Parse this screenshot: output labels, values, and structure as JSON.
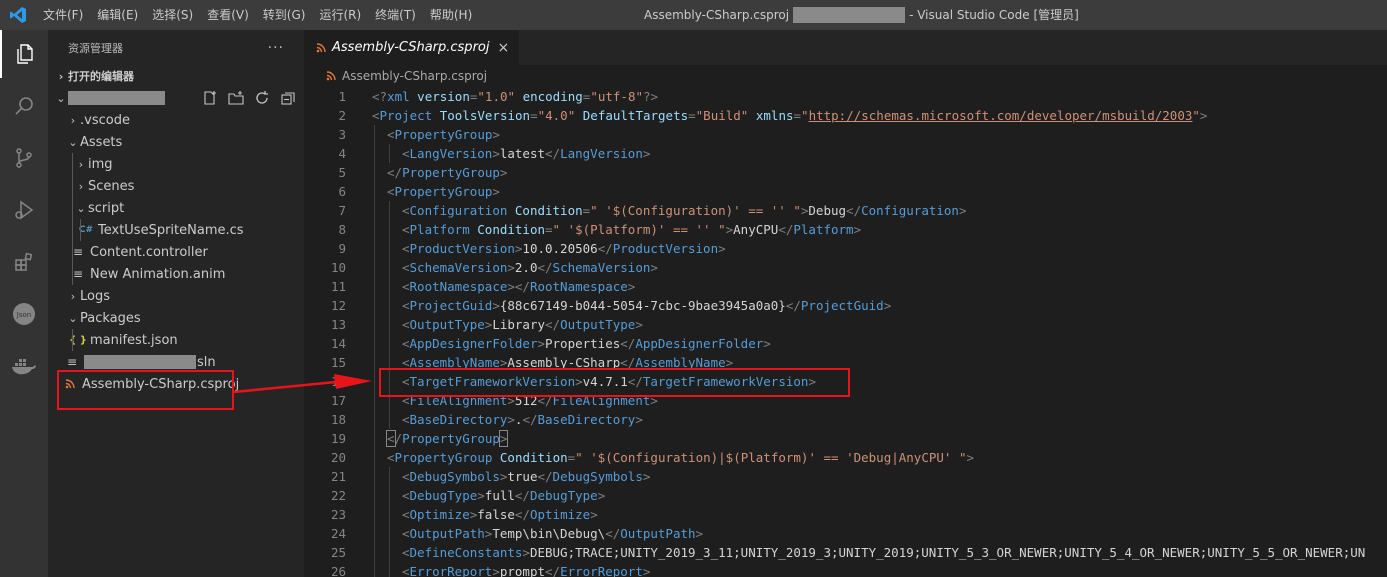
{
  "titlebar": {
    "menus": [
      "文件(F)",
      "编辑(E)",
      "选择(S)",
      "查看(V)",
      "转到(G)",
      "运行(R)",
      "终端(T)",
      "帮助(H)"
    ],
    "title_left": "Assembly-CSharp.csproj",
    "title_right": "- Visual Studio Code [管理员]"
  },
  "activitybar": {
    "icons": [
      "explorer-icon",
      "search-icon",
      "source-control-icon",
      "run-debug-icon",
      "extensions-icon",
      "json-icon",
      "docker-icon"
    ]
  },
  "sidebar": {
    "title": "资源管理器",
    "more": "···",
    "open_editors": "打开的编辑器",
    "tree": [
      {
        "label": ".vscode",
        "twisty": "›"
      },
      {
        "label": "Assets",
        "twisty": "⌄"
      },
      {
        "label": "img",
        "twisty": "›"
      },
      {
        "label": "Scenes",
        "twisty": "›"
      },
      {
        "label": "script",
        "twisty": "⌄"
      },
      {
        "label": "TextUseSpriteName.cs",
        "icon": "C#"
      },
      {
        "label": "Content.controller",
        "icon": "≡"
      },
      {
        "label": "New Animation.anim",
        "icon": "≡"
      },
      {
        "label": "Logs",
        "twisty": "›"
      },
      {
        "label": "Packages",
        "twisty": "⌄"
      },
      {
        "label": "manifest.json",
        "icon": "{ }"
      },
      {
        "label": "sln",
        "icon": "≡"
      },
      {
        "label": "Assembly-CSharp.csproj",
        "icon": "rss"
      }
    ]
  },
  "editor": {
    "tab_label": "Assembly-CSharp.csproj",
    "tab_close": "×",
    "breadcrumb": "Assembly-CSharp.csproj",
    "lines": [
      {
        "n": "1",
        "indent": 0,
        "tokens": [
          [
            "p",
            "<?"
          ],
          [
            "t",
            "xml "
          ],
          [
            "a",
            "version"
          ],
          [
            "p",
            "="
          ],
          [
            "s",
            "\"1.0\""
          ],
          [
            "x",
            " "
          ],
          [
            "a",
            "encoding"
          ],
          [
            "p",
            "="
          ],
          [
            "s",
            "\"utf-8\""
          ],
          [
            "p",
            "?>"
          ]
        ]
      },
      {
        "n": "2",
        "indent": 0,
        "tokens": [
          [
            "p",
            "<"
          ],
          [
            "t",
            "Project "
          ],
          [
            "a",
            "ToolsVersion"
          ],
          [
            "p",
            "="
          ],
          [
            "s",
            "\"4.0\""
          ],
          [
            "x",
            " "
          ],
          [
            "a",
            "DefaultTargets"
          ],
          [
            "p",
            "="
          ],
          [
            "s",
            "\"Build\""
          ],
          [
            "x",
            " "
          ],
          [
            "a",
            "xmlns"
          ],
          [
            "p",
            "="
          ],
          [
            "s",
            "\""
          ],
          [
            "u",
            "http://schemas.microsoft.com/developer/msbuild/2003"
          ],
          [
            "s",
            "\""
          ],
          [
            "p",
            ">"
          ]
        ]
      },
      {
        "n": "3",
        "indent": 1,
        "tokens": [
          [
            "p",
            "<"
          ],
          [
            "t",
            "PropertyGroup"
          ],
          [
            "p",
            ">"
          ]
        ]
      },
      {
        "n": "4",
        "indent": 2,
        "tokens": [
          [
            "p",
            "<"
          ],
          [
            "t",
            "LangVersion"
          ],
          [
            "p",
            ">"
          ],
          [
            "x",
            "latest"
          ],
          [
            "p",
            "</"
          ],
          [
            "t",
            "LangVersion"
          ],
          [
            "p",
            ">"
          ]
        ]
      },
      {
        "n": "5",
        "indent": 1,
        "tokens": [
          [
            "p",
            "</"
          ],
          [
            "t",
            "PropertyGroup"
          ],
          [
            "p",
            ">"
          ]
        ]
      },
      {
        "n": "6",
        "indent": 1,
        "tokens": [
          [
            "p",
            "<"
          ],
          [
            "t",
            "PropertyGroup"
          ],
          [
            "p",
            ">"
          ]
        ]
      },
      {
        "n": "7",
        "indent": 2,
        "tokens": [
          [
            "p",
            "<"
          ],
          [
            "t",
            "Configuration "
          ],
          [
            "a",
            "Condition"
          ],
          [
            "p",
            "="
          ],
          [
            "s",
            "\" '$(Configuration)' == '' \""
          ],
          [
            "p",
            ">"
          ],
          [
            "x",
            "Debug"
          ],
          [
            "p",
            "</"
          ],
          [
            "t",
            "Configuration"
          ],
          [
            "p",
            ">"
          ]
        ]
      },
      {
        "n": "8",
        "indent": 2,
        "tokens": [
          [
            "p",
            "<"
          ],
          [
            "t",
            "Platform "
          ],
          [
            "a",
            "Condition"
          ],
          [
            "p",
            "="
          ],
          [
            "s",
            "\" '$(Platform)' == '' \""
          ],
          [
            "p",
            ">"
          ],
          [
            "x",
            "AnyCPU"
          ],
          [
            "p",
            "</"
          ],
          [
            "t",
            "Platform"
          ],
          [
            "p",
            ">"
          ]
        ]
      },
      {
        "n": "9",
        "indent": 2,
        "tokens": [
          [
            "p",
            "<"
          ],
          [
            "t",
            "ProductVersion"
          ],
          [
            "p",
            ">"
          ],
          [
            "x",
            "10.0.20506"
          ],
          [
            "p",
            "</"
          ],
          [
            "t",
            "ProductVersion"
          ],
          [
            "p",
            ">"
          ]
        ]
      },
      {
        "n": "10",
        "indent": 2,
        "tokens": [
          [
            "p",
            "<"
          ],
          [
            "t",
            "SchemaVersion"
          ],
          [
            "p",
            ">"
          ],
          [
            "x",
            "2.0"
          ],
          [
            "p",
            "</"
          ],
          [
            "t",
            "SchemaVersion"
          ],
          [
            "p",
            ">"
          ]
        ]
      },
      {
        "n": "11",
        "indent": 2,
        "tokens": [
          [
            "p",
            "<"
          ],
          [
            "t",
            "RootNamespace"
          ],
          [
            "p",
            "></"
          ],
          [
            "t",
            "RootNamespace"
          ],
          [
            "p",
            ">"
          ]
        ]
      },
      {
        "n": "12",
        "indent": 2,
        "tokens": [
          [
            "p",
            "<"
          ],
          [
            "t",
            "ProjectGuid"
          ],
          [
            "p",
            ">"
          ],
          [
            "x",
            "{88c67149-b044-5054-7cbc-9bae3945a0a0}"
          ],
          [
            "p",
            "</"
          ],
          [
            "t",
            "ProjectGuid"
          ],
          [
            "p",
            ">"
          ]
        ]
      },
      {
        "n": "13",
        "indent": 2,
        "tokens": [
          [
            "p",
            "<"
          ],
          [
            "t",
            "OutputType"
          ],
          [
            "p",
            ">"
          ],
          [
            "x",
            "Library"
          ],
          [
            "p",
            "</"
          ],
          [
            "t",
            "OutputType"
          ],
          [
            "p",
            ">"
          ]
        ]
      },
      {
        "n": "14",
        "indent": 2,
        "tokens": [
          [
            "p",
            "<"
          ],
          [
            "t",
            "AppDesignerFolder"
          ],
          [
            "p",
            ">"
          ],
          [
            "x",
            "Properties"
          ],
          [
            "p",
            "</"
          ],
          [
            "t",
            "AppDesignerFolder"
          ],
          [
            "p",
            ">"
          ]
        ]
      },
      {
        "n": "15",
        "indent": 2,
        "tokens": [
          [
            "p",
            "<"
          ],
          [
            "t",
            "AssemblyName"
          ],
          [
            "p",
            ">"
          ],
          [
            "x",
            "Assembly-CSharp"
          ],
          [
            "p",
            "</"
          ],
          [
            "t",
            "AssemblyName"
          ],
          [
            "p",
            ">"
          ]
        ]
      },
      {
        "n": "16",
        "indent": 2,
        "tokens": [
          [
            "p",
            "<"
          ],
          [
            "t",
            "TargetFrameworkVersion"
          ],
          [
            "p",
            ">"
          ],
          [
            "x",
            "v4.7.1"
          ],
          [
            "p",
            "</"
          ],
          [
            "t",
            "TargetFrameworkVersion"
          ],
          [
            "p",
            ">"
          ]
        ]
      },
      {
        "n": "17",
        "indent": 2,
        "tokens": [
          [
            "p",
            "<"
          ],
          [
            "t",
            "FileAlignment"
          ],
          [
            "p",
            ">"
          ],
          [
            "x",
            "512"
          ],
          [
            "p",
            "</"
          ],
          [
            "t",
            "FileAlignment"
          ],
          [
            "p",
            ">"
          ]
        ]
      },
      {
        "n": "18",
        "indent": 2,
        "tokens": [
          [
            "p",
            "<"
          ],
          [
            "t",
            "BaseDirectory"
          ],
          [
            "p",
            ">"
          ],
          [
            "x",
            "."
          ],
          [
            "p",
            "</"
          ],
          [
            "t",
            "BaseDirectory"
          ],
          [
            "p",
            ">"
          ]
        ]
      },
      {
        "n": "19",
        "indent": 1,
        "tokens": [
          [
            "b",
            "<"
          ],
          [
            "p",
            "/"
          ],
          [
            "t",
            "PropertyGroup"
          ],
          [
            "b",
            ">"
          ]
        ]
      },
      {
        "n": "20",
        "indent": 1,
        "tokens": [
          [
            "p",
            "<"
          ],
          [
            "t",
            "PropertyGroup "
          ],
          [
            "a",
            "Condition"
          ],
          [
            "p",
            "="
          ],
          [
            "s",
            "\" '$(Configuration)|$(Platform)' == 'Debug|AnyCPU' \""
          ],
          [
            "p",
            ">"
          ]
        ]
      },
      {
        "n": "21",
        "indent": 2,
        "tokens": [
          [
            "p",
            "<"
          ],
          [
            "t",
            "DebugSymbols"
          ],
          [
            "p",
            ">"
          ],
          [
            "x",
            "true"
          ],
          [
            "p",
            "</"
          ],
          [
            "t",
            "DebugSymbols"
          ],
          [
            "p",
            ">"
          ]
        ]
      },
      {
        "n": "22",
        "indent": 2,
        "tokens": [
          [
            "p",
            "<"
          ],
          [
            "t",
            "DebugType"
          ],
          [
            "p",
            ">"
          ],
          [
            "x",
            "full"
          ],
          [
            "p",
            "</"
          ],
          [
            "t",
            "DebugType"
          ],
          [
            "p",
            ">"
          ]
        ]
      },
      {
        "n": "23",
        "indent": 2,
        "tokens": [
          [
            "p",
            "<"
          ],
          [
            "t",
            "Optimize"
          ],
          [
            "p",
            ">"
          ],
          [
            "x",
            "false"
          ],
          [
            "p",
            "</"
          ],
          [
            "t",
            "Optimize"
          ],
          [
            "p",
            ">"
          ]
        ]
      },
      {
        "n": "24",
        "indent": 2,
        "tokens": [
          [
            "p",
            "<"
          ],
          [
            "t",
            "OutputPath"
          ],
          [
            "p",
            ">"
          ],
          [
            "x",
            "Temp\\bin\\Debug\\"
          ],
          [
            "p",
            "</"
          ],
          [
            "t",
            "OutputPath"
          ],
          [
            "p",
            ">"
          ]
        ]
      },
      {
        "n": "25",
        "indent": 2,
        "tokens": [
          [
            "p",
            "<"
          ],
          [
            "t",
            "DefineConstants"
          ],
          [
            "p",
            ">"
          ],
          [
            "x",
            "DEBUG;TRACE;UNITY_2019_3_11;UNITY_2019_3;UNITY_2019;UNITY_5_3_OR_NEWER;UNITY_5_4_OR_NEWER;UNITY_5_5_OR_NEWER;UN"
          ]
        ]
      },
      {
        "n": "26",
        "indent": 2,
        "tokens": [
          [
            "p",
            "<"
          ],
          [
            "t",
            "ErrorReport"
          ],
          [
            "p",
            ">"
          ],
          [
            "x",
            "prompt"
          ],
          [
            "p",
            "</"
          ],
          [
            "t",
            "ErrorReport"
          ],
          [
            "p",
            ">"
          ]
        ]
      }
    ]
  },
  "colors": {
    "annotation": "#e8141c",
    "tag": "#569cd6",
    "attribute": "#9cdcfe",
    "string": "#ce9178"
  }
}
